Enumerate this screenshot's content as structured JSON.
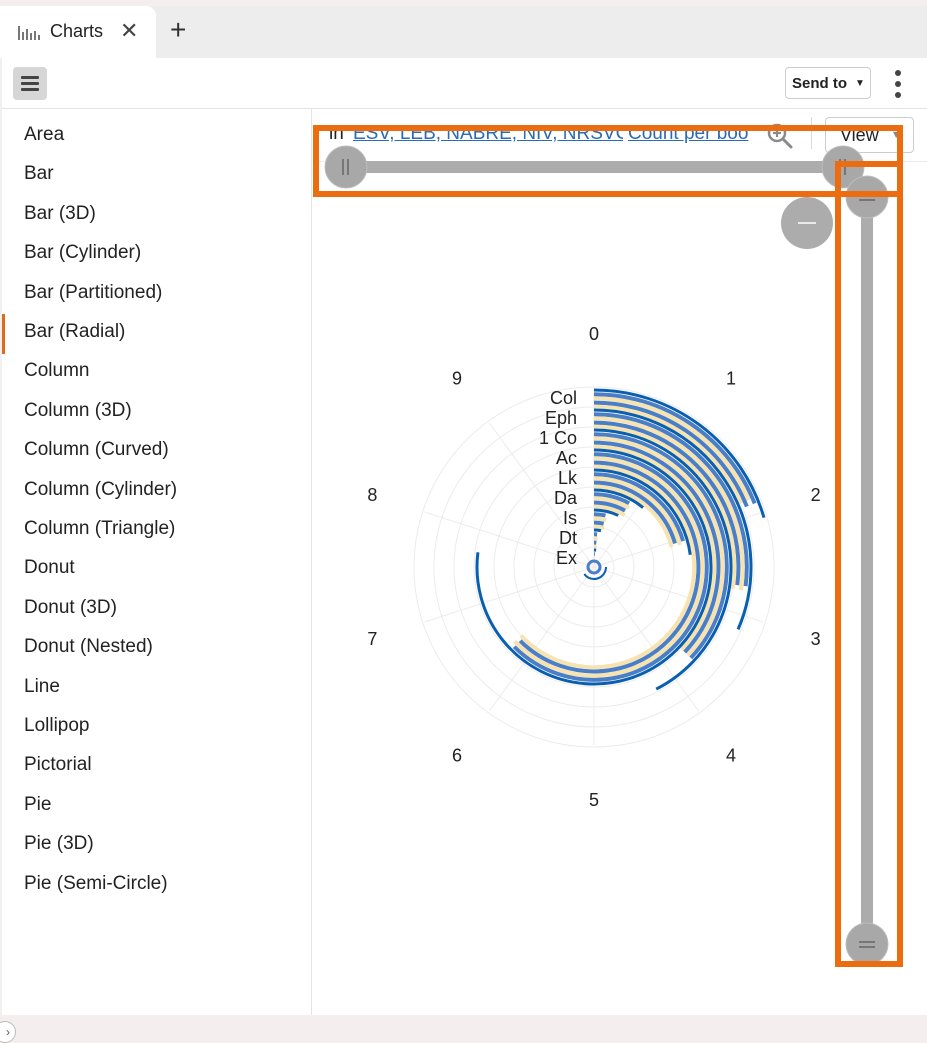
{
  "tab": {
    "title": "Charts",
    "close": "✕",
    "add": "+"
  },
  "toolbar": {
    "send_to": "Send to",
    "send_to_caret": "▼"
  },
  "sidebar": {
    "active_index": 5,
    "items": [
      {
        "label": "Area"
      },
      {
        "label": "Bar"
      },
      {
        "label": "Bar (3D)"
      },
      {
        "label": "Bar (Cylinder)"
      },
      {
        "label": "Bar (Partitioned)"
      },
      {
        "label": "Bar (Radial)"
      },
      {
        "label": "Column"
      },
      {
        "label": "Column (3D)"
      },
      {
        "label": "Column (Curved)"
      },
      {
        "label": "Column (Cylinder)"
      },
      {
        "label": "Column (Triangle)"
      },
      {
        "label": "Donut"
      },
      {
        "label": "Donut (3D)"
      },
      {
        "label": "Donut (Nested)"
      },
      {
        "label": "Line"
      },
      {
        "label": "Lollipop"
      },
      {
        "label": "Pictorial"
      },
      {
        "label": "Pie"
      },
      {
        "label": "Pie (3D)"
      },
      {
        "label": "Pie (Semi-Circle)"
      }
    ]
  },
  "query": {
    "prefix": "in",
    "versions": "ESV, LEB, NABRE, NIV, NRSVCE",
    "measure": "Count per boo",
    "view": "View"
  },
  "colors": {
    "accent": "#e0691a",
    "highlight": "#ec6c10",
    "link": "#2a6bb5",
    "series": [
      "#0b5fb0",
      "#4a7fc8",
      "#f6e3b0"
    ]
  },
  "chart_data": {
    "type": "radial-bar",
    "angle_ticks": [
      "0",
      "1",
      "2",
      "3",
      "4",
      "5",
      "6",
      "7",
      "8",
      "9"
    ],
    "angle_max": 10,
    "categories": [
      "Col",
      "Eph",
      "1 Co",
      "Ac",
      "Lk",
      "Da",
      "Is",
      "Dt",
      "Ex"
    ],
    "series": [
      {
        "values": [
          2.05,
          3.15,
          4.25,
          7.7,
          2.3,
          1.1,
          0.7,
          0.3,
          0.2
        ]
      },
      {
        "values": [
          1.9,
          2.7,
          3.7,
          6.25,
          2.05,
          0.8,
          0.35,
          0.15,
          0.1
        ]
      },
      {
        "values": [
          1.85,
          2.75,
          3.7,
          6.3,
          2.1,
          0.85,
          0.4,
          0.2,
          0.1
        ]
      },
      {
        "values": [
          1.9,
          2.7,
          3.7,
          6.25,
          2.05,
          0.8,
          0.35,
          0.15,
          0.1
        ]
      },
      {
        "values": [
          1.85,
          2.75,
          3.7,
          6.3,
          2.1,
          0.85,
          0.4,
          0.2,
          0.1
        ]
      }
    ]
  }
}
